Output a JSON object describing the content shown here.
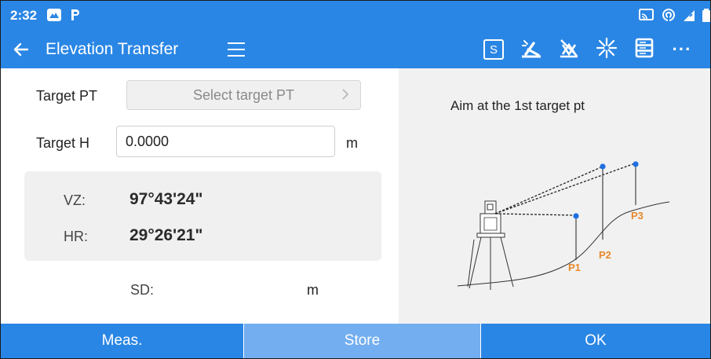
{
  "status": {
    "time": "2:32",
    "icons": [
      "mountain-badge-icon",
      "p-badge-icon",
      "cast-icon",
      "hotspot-icon",
      "signal-icon",
      "battery-icon"
    ]
  },
  "appbar": {
    "title": "Elevation Transfer",
    "icons": [
      "back-arrow-icon",
      "menu-icon",
      "s-box-icon",
      "laser-icon",
      "no-prism-icon",
      "sparkle-icon",
      "list-icon",
      "more-icon"
    ],
    "s_label": "S",
    "more_label": "···"
  },
  "form": {
    "target_pt_label": "Target PT",
    "target_pt_placeholder": "Select target PT",
    "target_h_label": "Target H",
    "target_h_value": "0.0000",
    "target_h_unit": "m"
  },
  "angles": {
    "vz_label": "VZ:",
    "vz_value": "97°43'24\"",
    "hr_label": "HR:",
    "hr_value": "29°26'21\""
  },
  "sd": {
    "label": "SD:",
    "unit": "m"
  },
  "diagram": {
    "hint": "Aim at the 1st target pt",
    "points": [
      "P1",
      "P2",
      "P3"
    ]
  },
  "buttons": {
    "meas": "Meas.",
    "store": "Store",
    "ok": "OK"
  },
  "colors": {
    "primary": "#2a86e4",
    "store_button": "#73aef0",
    "point_label": "#e8882b",
    "target_dot": "#1f6fe0"
  }
}
